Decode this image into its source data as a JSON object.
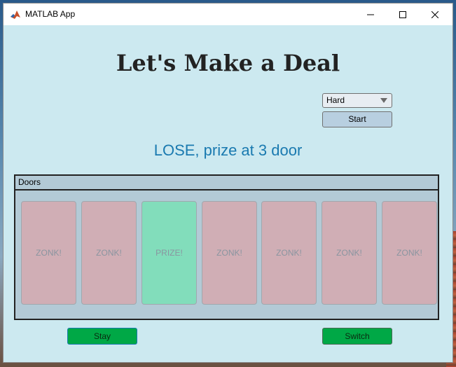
{
  "window": {
    "title": "MATLAB App"
  },
  "heading": "Let's Make a Deal",
  "difficulty": {
    "selected": "Hard"
  },
  "start_label": "Start",
  "status": "LOSE, prize at 3 door",
  "panel": {
    "title": "Doors",
    "doors": [
      {
        "label": "ZONK!",
        "state": "zonk"
      },
      {
        "label": "ZONK!",
        "state": "zonk"
      },
      {
        "label": "PRIZE!",
        "state": "prize"
      },
      {
        "label": "ZONK!",
        "state": "zonk"
      },
      {
        "label": "ZONK!",
        "state": "zonk"
      },
      {
        "label": "ZONK!",
        "state": "zonk"
      },
      {
        "label": "ZONK!",
        "state": "zonk"
      }
    ]
  },
  "actions": {
    "stay_label": "Stay",
    "switch_label": "Switch"
  },
  "colors": {
    "background": "#cce9f0",
    "zonk": "#d0aeb5",
    "prize": "#82ddbb",
    "action_button": "#00a846",
    "status_text": "#1a7ab0"
  }
}
